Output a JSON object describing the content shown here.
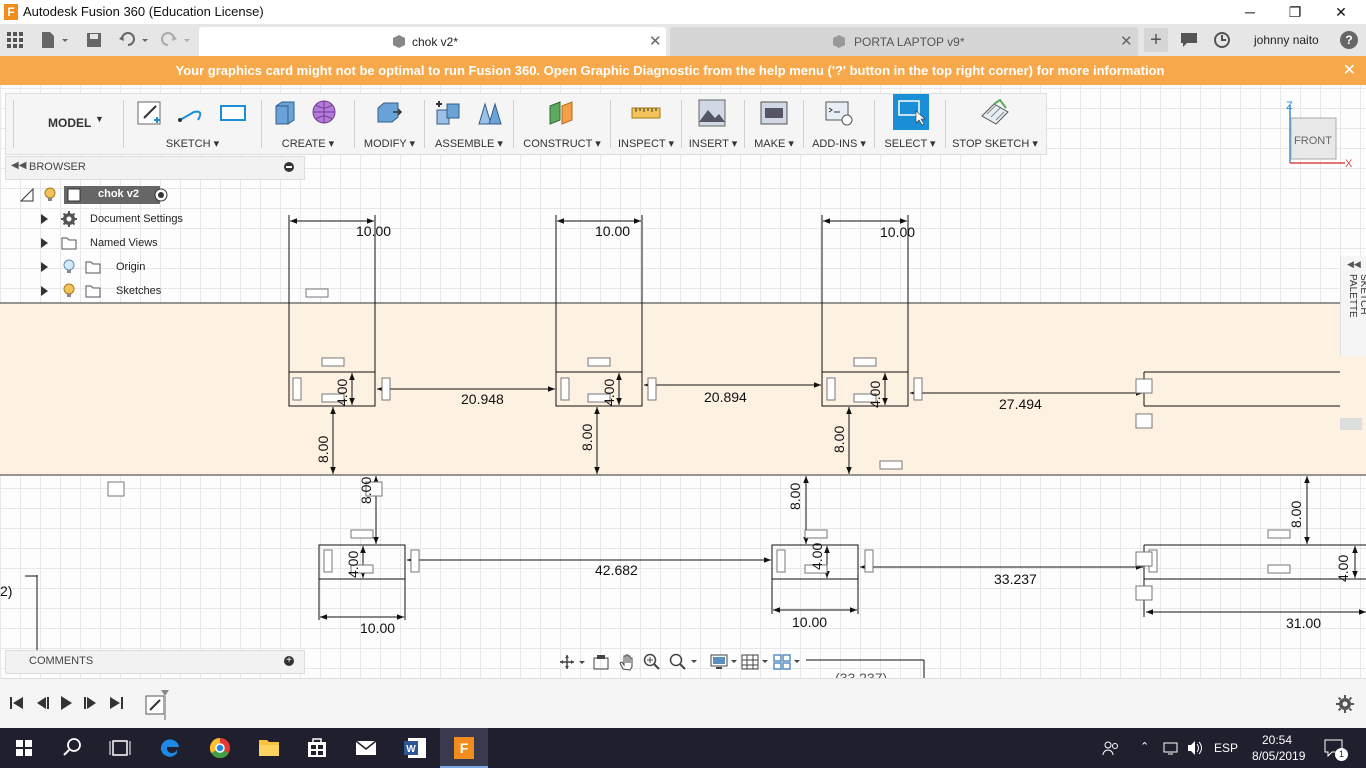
{
  "window": {
    "title": "Autodesk Fusion 360 (Education License)",
    "logo_letter": "F",
    "minimize": "─",
    "maximize": "❐",
    "close": "✕"
  },
  "tabs": [
    {
      "label": "chok v2*",
      "active": true
    },
    {
      "label": "PORTA LAPTOP v9*",
      "active": false
    }
  ],
  "user": {
    "name": "johnny naito",
    "help": "?"
  },
  "banner": {
    "message": "Your graphics card might not be optimal to run Fusion 360. Open Graphic Diagnostic from the help menu ('?' button in the top right corner) for more information",
    "close": "✕"
  },
  "toolbar": {
    "workspace": "MODEL",
    "groups": [
      "SKETCH",
      "CREATE",
      "MODIFY",
      "ASSEMBLE",
      "CONSTRUCT",
      "INSPECT",
      "INSERT",
      "MAKE",
      "ADD-INS",
      "SELECT",
      "STOP SKETCH"
    ]
  },
  "viewcube": {
    "face": "FRONT",
    "axis_z": "Z",
    "axis_x": "X"
  },
  "browser": {
    "title": "BROWSER",
    "root": "chok v2",
    "items": [
      "Document Settings",
      "Named Views",
      "Origin",
      "Sketches"
    ]
  },
  "comments": {
    "title": "COMMENTS"
  },
  "palette": {
    "title": "SKETCH PALETTE"
  },
  "dimensions": {
    "widths": [
      "10.00",
      "10.00",
      "10.00",
      "10.00",
      "10.00",
      "31.00"
    ],
    "heights": [
      "4.00",
      "4.00",
      "4.00",
      "4.00",
      "4.00",
      "4.00"
    ],
    "spacings": [
      "20.948",
      "20.894",
      "27.494",
      "42.682",
      "33.237"
    ],
    "verticals": [
      "8.00",
      "8.00",
      "8.00",
      "8.00",
      "8.00",
      "8.00"
    ],
    "ghost": "(33.237)",
    "edge_label": "2)"
  },
  "taskbar": {
    "lang": "ESP",
    "time": "20:54",
    "date": "8/05/2019",
    "notifications": "1"
  },
  "colors": {
    "banner": "#f7a84a",
    "accent_select": "#1a8fd8",
    "taskbar": "#1f1f2e",
    "fusion_orange": "#f28c1c"
  }
}
